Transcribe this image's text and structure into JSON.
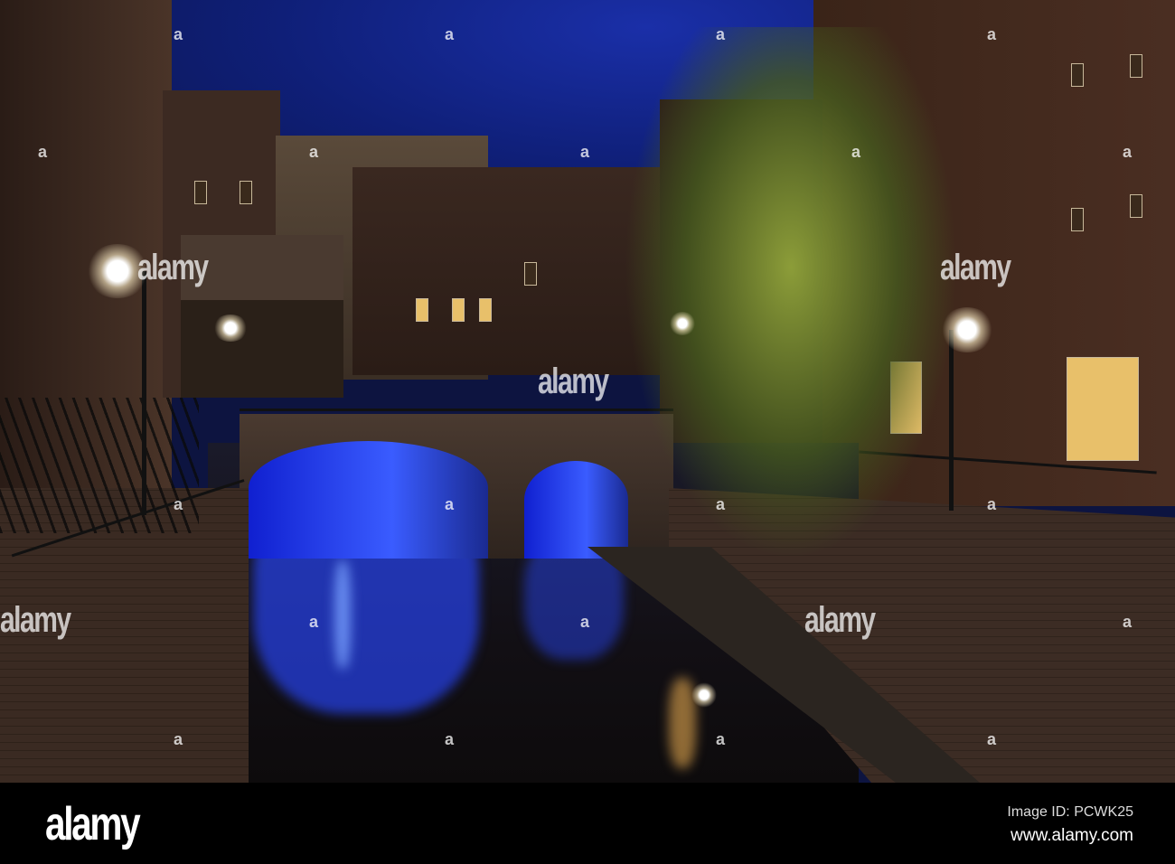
{
  "watermark": {
    "text": "alamy",
    "mark": "a"
  },
  "footer": {
    "logo": "alamy",
    "image_id": "Image ID: PCWK25",
    "url": "www.alamy.com"
  }
}
